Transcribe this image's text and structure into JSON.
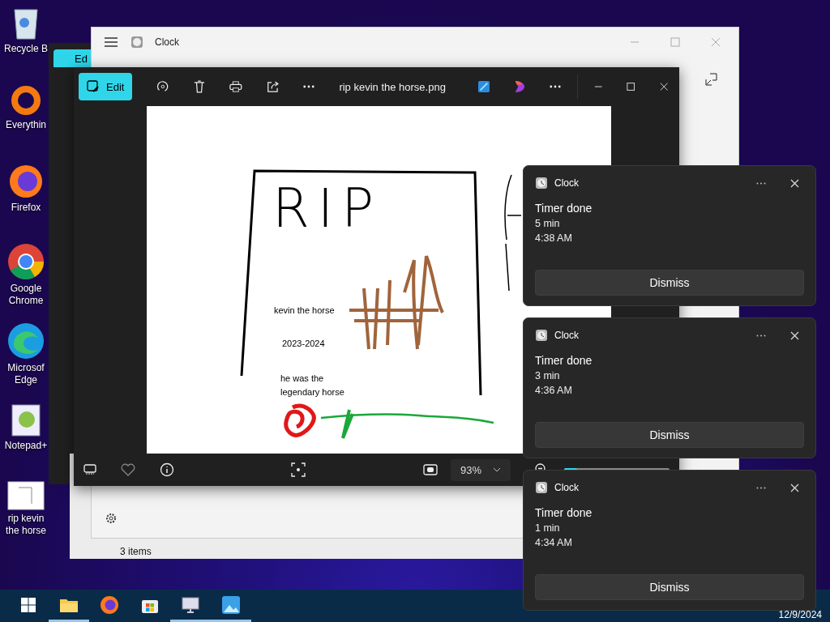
{
  "desktop_icons": [
    {
      "label": "Recycle B",
      "kind": "bin"
    },
    {
      "label": "Everythin",
      "kind": "ring"
    },
    {
      "label": "Firefox",
      "kind": "firefox"
    },
    {
      "label": "Google Chrome",
      "kind": "chrome"
    },
    {
      "label": "Microsof Edge",
      "kind": "edge"
    },
    {
      "label": "Notepad+",
      "kind": "notepad"
    },
    {
      "label": "rip kevin the horse",
      "kind": "image"
    }
  ],
  "clock_window": {
    "title": "Clock"
  },
  "back_photos_window": {
    "edit_label": "Ed"
  },
  "explorer_window": {
    "status": "3 items"
  },
  "photos_window": {
    "edit_label": "Edit",
    "file_name": "rip kevin the horse.png",
    "zoom": "93%",
    "zoom_slider": {
      "level": 0.12
    }
  },
  "image": {
    "heading": "RIP",
    "name": "kevin the horse",
    "years": "2023-2024",
    "epitaph": "he was the legendary horse"
  },
  "notifications": [
    {
      "app": "Clock",
      "title": "Timer done",
      "duration": "5 min",
      "time": "4:38 AM",
      "button": "Dismiss"
    },
    {
      "app": "Clock",
      "title": "Timer done",
      "duration": "3 min",
      "time": "4:36 AM",
      "button": "Dismiss"
    },
    {
      "app": "Clock",
      "title": "Timer done",
      "duration": "1 min",
      "time": "4:34 AM",
      "button": "Dismiss"
    }
  ],
  "taskbar": {
    "items": [
      {
        "kind": "start",
        "running": false
      },
      {
        "kind": "folder",
        "running": true
      },
      {
        "kind": "firefox",
        "running": false
      },
      {
        "kind": "store",
        "running": false
      },
      {
        "kind": "monitor",
        "running": true
      },
      {
        "kind": "photos",
        "running": true
      }
    ],
    "date": "12/9/2024"
  }
}
